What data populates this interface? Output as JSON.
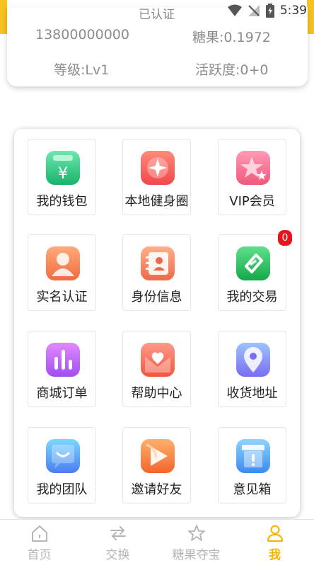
{
  "status_bar": {
    "verified_text": "已认证",
    "time": "5:39"
  },
  "profile": {
    "phone": "13800000000",
    "candy": "糖果:0.1972",
    "level": "等级:Lv1",
    "activity": "活跃度:0+0"
  },
  "menu": {
    "items": [
      {
        "label": "我的钱包",
        "icon": "wallet-icon"
      },
      {
        "label": "本地健身圈",
        "icon": "fitness-circle-icon"
      },
      {
        "label": "VIP会员",
        "icon": "vip-star-icon"
      },
      {
        "label": "实名认证",
        "icon": "user-verify-icon"
      },
      {
        "label": "身份信息",
        "icon": "id-card-icon"
      },
      {
        "label": "我的交易",
        "icon": "trade-icon",
        "badge": "0"
      },
      {
        "label": "商城订单",
        "icon": "bar-chart-icon"
      },
      {
        "label": "帮助中心",
        "icon": "heart-mail-icon"
      },
      {
        "label": "收货地址",
        "icon": "location-pin-icon"
      },
      {
        "label": "我的团队",
        "icon": "chat-bubble-icon"
      },
      {
        "label": "邀请好友",
        "icon": "invite-play-icon"
      },
      {
        "label": "意见箱",
        "icon": "suggestion-box-icon"
      }
    ]
  },
  "tabbar": {
    "tabs": [
      {
        "label": "首页",
        "icon": "home-icon"
      },
      {
        "label": "交换",
        "icon": "exchange-icon"
      },
      {
        "label": "糖果夺宝",
        "icon": "star-icon"
      },
      {
        "label": "我",
        "icon": "person-icon",
        "active": true
      }
    ]
  },
  "colors": {
    "accent": "#f7c21e",
    "active_tab": "#f5b400",
    "badge": "#e8141b"
  }
}
